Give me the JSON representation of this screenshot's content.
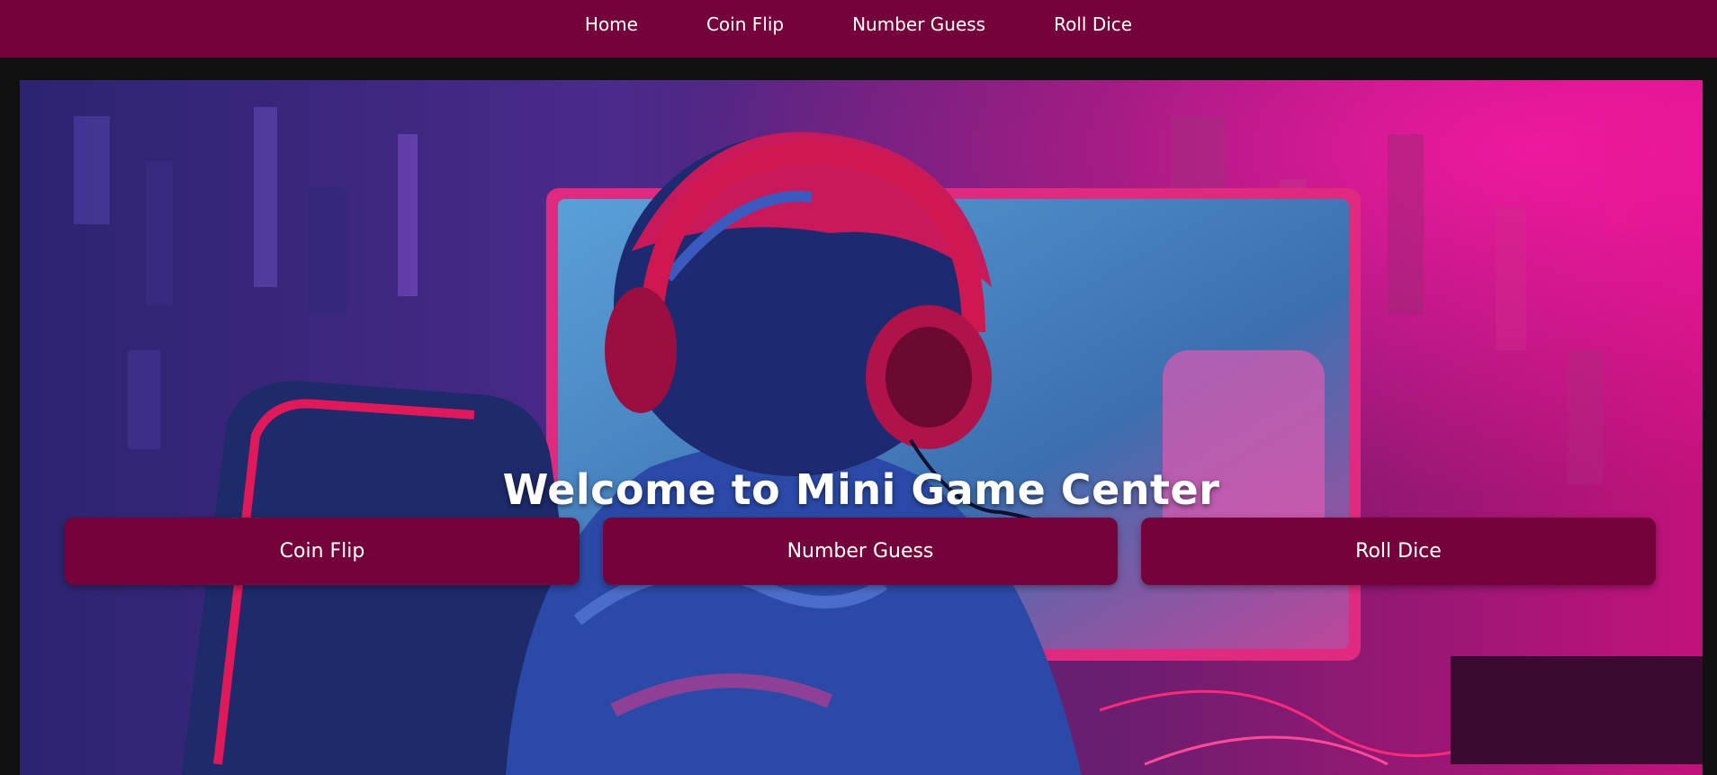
{
  "nav": {
    "items": [
      {
        "label": "Home"
      },
      {
        "label": "Coin Flip"
      },
      {
        "label": "Number Guess"
      },
      {
        "label": "Roll Dice"
      }
    ]
  },
  "hero": {
    "title": "Welcome to Mini Game Center",
    "image_icon": "gamer-with-headphones-illustration",
    "buttons": [
      {
        "label": "Coin Flip"
      },
      {
        "label": "Number Guess"
      },
      {
        "label": "Roll Dice"
      }
    ]
  },
  "colors": {
    "accent": "#74033b",
    "page_bg": "#111111",
    "text": "#ffffff"
  }
}
